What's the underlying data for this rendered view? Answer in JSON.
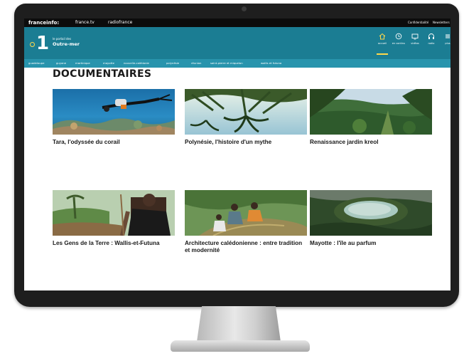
{
  "topbar": {
    "brand": "franceinfo:",
    "sites": [
      "france.tv",
      "radiofrance"
    ],
    "confidentiality": "Confidentialité",
    "newsletters": "Newsletters"
  },
  "header": {
    "logo_number": "1",
    "logo_tagline": "le portail des",
    "logo_name": "Outre-mer",
    "nav": [
      {
        "label": "accueil",
        "icon": "home-icon"
      },
      {
        "label": "en continu",
        "icon": "clock-icon"
      },
      {
        "label": "vidéos",
        "icon": "tv-icon"
      },
      {
        "label": "radio",
        "icon": "headphones-icon"
      },
      {
        "label": "plus",
        "icon": "menu-icon"
      }
    ]
  },
  "territories": [
    "guadeloupe",
    "guyane",
    "martinique",
    "mayotte",
    "nouvelle-calédonie",
    "polynésie",
    "réunion",
    "saint-pierre et miquelon",
    "wallis et futuna"
  ],
  "page": {
    "title": "DOCUMENTAIRES",
    "cards": [
      {
        "caption": "Tara, l'odyssée du corail"
      },
      {
        "caption": "Polynésie, l'histoire d'un mythe"
      },
      {
        "caption": "Renaissance jardin kreol"
      },
      {
        "caption": "Les Gens de la Terre : Wallis-et-Futuna"
      },
      {
        "caption": "Architecture calédonienne : entre tradition et modernité"
      },
      {
        "caption": "Mayotte : l'île au parfum"
      }
    ]
  },
  "colors": {
    "header_teal": "#1b7d93",
    "territories_blue": "#2894ad",
    "accent_yellow": "#ffd84a"
  }
}
